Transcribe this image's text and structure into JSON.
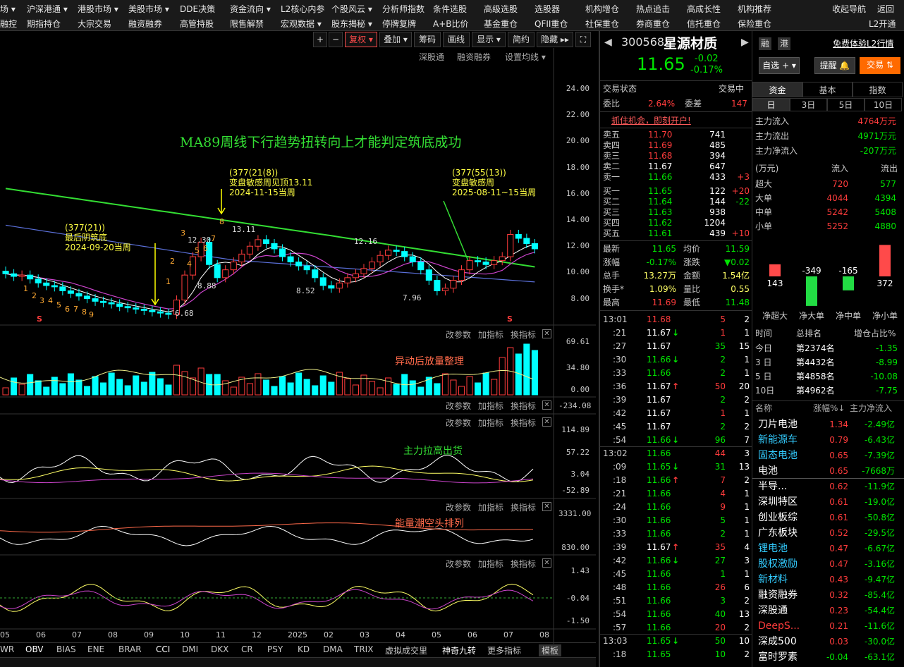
{
  "menu_row1": [
    {
      "label": "场 ▾",
      "x": 0
    },
    {
      "label": "沪深港通 ▾",
      "x": 38
    },
    {
      "label": "港股市场 ▾",
      "x": 110
    },
    {
      "label": "美股市场 ▾",
      "x": 182
    },
    {
      "label": "DDE决策",
      "x": 255
    },
    {
      "label": "资金流向 ▾",
      "x": 326
    },
    {
      "label": "L2核心内参",
      "x": 398
    },
    {
      "label": "个股风云 ▾",
      "x": 470
    },
    {
      "label": "分析师指数",
      "x": 542
    },
    {
      "label": "条件选股",
      "x": 614
    },
    {
      "label": "高级选股",
      "x": 686
    },
    {
      "label": "选股器",
      "x": 758
    },
    {
      "label": "机构增仓",
      "x": 830
    },
    {
      "label": "热点追击",
      "x": 902
    },
    {
      "label": "高成长性",
      "x": 974
    },
    {
      "label": "机构推荐",
      "x": 1046
    },
    {
      "label": "收起导航",
      "x": 1180
    },
    {
      "label": "返回",
      "x": 1244
    }
  ],
  "menu_row2": [
    {
      "label": "融控",
      "x": 0
    },
    {
      "label": "期指持仓",
      "x": 38
    },
    {
      "label": "大宗交易",
      "x": 110
    },
    {
      "label": "融资融券",
      "x": 182
    },
    {
      "label": "高管持股",
      "x": 255
    },
    {
      "label": "限售解禁",
      "x": 326
    },
    {
      "label": "宏观数据 ▾",
      "x": 398
    },
    {
      "label": "股东揭秘 ▾",
      "x": 470
    },
    {
      "label": "停牌复牌",
      "x": 542
    },
    {
      "label": "A+B比价",
      "x": 614
    },
    {
      "label": "基金重仓",
      "x": 686
    },
    {
      "label": "QFII重仓",
      "x": 758
    },
    {
      "label": "社保重仓",
      "x": 830
    },
    {
      "label": "券商重仓",
      "x": 902
    },
    {
      "label": "信托重仓",
      "x": 974
    },
    {
      "label": "保险重仓",
      "x": 1046
    },
    {
      "label": "L2开通",
      "x": 1232
    }
  ],
  "toolbar": {
    "plus": "+",
    "minus": "−",
    "fuquan": "复权 ▾",
    "diejia": "叠加 ▾",
    "chouma": "筹码",
    "huaxian": "画线",
    "xianshi": "显示 ▾",
    "jianyue": "简约",
    "yincang": "隐藏 ▸▸",
    "full": "⛶"
  },
  "main_chart": {
    "top_links": [
      "深股通",
      "融资融券",
      "设置均线 ▾"
    ],
    "y_ticks": [
      "24.00",
      "22.00",
      "20.00",
      "18.00",
      "16.00",
      "14.00",
      "12.00",
      "10.00",
      "8.00"
    ],
    "headline": "MA89周线下行趋势扭转向上才能判定筑底成功",
    "annotations": [
      {
        "l1": "(377(21))",
        "l2": "最后阴筑底",
        "l3": "2024-09-20当周"
      },
      {
        "l1": "(377(21(8))",
        "l2": "变盘敏感周见顶13.11",
        "l3": "2024-11-15当周"
      },
      {
        "l1": "(377(55(13))",
        "l2": "变盘敏感周",
        "l3": "2025-08-11~15当周"
      }
    ],
    "price_labels": [
      "12.30",
      "13.11",
      "8.88",
      "8.52",
      "12.16",
      "7.96",
      "6.68"
    ],
    "td_counts_left": [
      "1",
      "2",
      "3",
      "4",
      "5",
      "6",
      "7",
      "8",
      "9"
    ],
    "td_counts_right": [
      "1",
      "2",
      "3",
      "4",
      "5",
      "6",
      "7",
      "8"
    ],
    "s_marks": [
      "S",
      "S"
    ]
  },
  "panels": {
    "links": [
      "改参数",
      "加指标",
      "换指标"
    ],
    "vol": {
      "note": "异动后放量整理",
      "y": [
        "69.61",
        "34.80",
        "0.00"
      ]
    },
    "p2": {
      "y": [
        "-234.08"
      ],
      "extra": "−234.08"
    },
    "main_force": {
      "note": "主力拉高出货",
      "y": [
        "114.89",
        "57.22",
        "3.04",
        "-52.89"
      ]
    },
    "energy": {
      "note": "能量潮空头排列",
      "y": [
        "3331.00",
        "830.00"
      ]
    },
    "osc": {
      "y": [
        "1.43",
        "-0.04",
        "-1.50"
      ]
    }
  },
  "x_axis": [
    "05",
    "06",
    "07",
    "08",
    "09",
    "10",
    "11",
    "12",
    "2025",
    "02",
    "03",
    "04",
    "05",
    "06",
    "07",
    "08"
  ],
  "indicator_tabs": [
    "WR",
    "OBV",
    "BIAS",
    "ENE",
    "BRAR",
    "CCI",
    "DMI",
    "DKX",
    "CR",
    "PSY",
    "KD",
    "DMA",
    "TRIX",
    "虚拟成交里",
    "神奇九转",
    "更多指标",
    "模板"
  ],
  "quote": {
    "code": "300568",
    "name": "星源材质",
    "price": "11.65",
    "change": "-0.02",
    "change_pct": "-0.17%",
    "tag1": "融",
    "tag2": "港",
    "l2_link": "免费体验L2行情",
    "btn_zixuan": "自选 + ▾",
    "btn_tixing": "提醒 🔔",
    "btn_jiaoyi": "交易 ⇅",
    "status_label": "交易状态",
    "status_value": "交易中",
    "weibi_label": "委比",
    "weibi": "2.64%",
    "weicha_label": "委差",
    "weicha": "147",
    "promo": "抓住机会，即刻开户!"
  },
  "asks": [
    {
      "label": "卖五",
      "price": "11.70",
      "vol": "741",
      "chg": ""
    },
    {
      "label": "卖四",
      "price": "11.69",
      "vol": "485",
      "chg": ""
    },
    {
      "label": "卖三",
      "price": "11.68",
      "vol": "394",
      "chg": ""
    },
    {
      "label": "卖二",
      "price": "11.67",
      "vol": "647",
      "chg": ""
    },
    {
      "label": "卖一",
      "price": "11.66",
      "vol": "433",
      "chg": "+3"
    }
  ],
  "bids": [
    {
      "label": "买一",
      "price": "11.65",
      "vol": "122",
      "chg": "+20"
    },
    {
      "label": "买二",
      "price": "11.64",
      "vol": "144",
      "chg": "-22"
    },
    {
      "label": "买三",
      "price": "11.63",
      "vol": "938",
      "chg": ""
    },
    {
      "label": "买四",
      "price": "11.62",
      "vol": "1204",
      "chg": ""
    },
    {
      "label": "买五",
      "price": "11.61",
      "vol": "439",
      "chg": "+10"
    }
  ],
  "stats": [
    {
      "l": "最新",
      "v": "11.65",
      "l2": "均价",
      "v2": "11.59"
    },
    {
      "l": "涨幅",
      "v": "-0.17%",
      "l2": "涨跌",
      "v2": "▼0.02"
    },
    {
      "l": "总手",
      "v": "13.27万",
      "l2": "金额",
      "v2": "1.54亿"
    },
    {
      "l": "换手*",
      "v": "1.09%",
      "l2": "量比",
      "v2": "0.55"
    },
    {
      "l": "最高",
      "v": "11.69",
      "l2": "最低",
      "v2": "11.48"
    }
  ],
  "ticks": [
    {
      "t": "13:01",
      "p": "11.68",
      "a": "",
      "v": "5",
      "n": "2",
      "pc": "red",
      "vc": "red"
    },
    {
      "t": ":21",
      "p": "11.67",
      "a": "↓",
      "v": "1",
      "n": "1",
      "pc": "white",
      "vc": "red"
    },
    {
      "t": ":27",
      "p": "11.67",
      "a": "",
      "v": "35",
      "n": "15",
      "pc": "white",
      "vc": "green"
    },
    {
      "t": ":30",
      "p": "11.66",
      "a": "↓",
      "v": "2",
      "n": "1",
      "pc": "green",
      "vc": "green"
    },
    {
      "t": ":33",
      "p": "11.66",
      "a": "",
      "v": "2",
      "n": "1",
      "pc": "green",
      "vc": "green"
    },
    {
      "t": ":36",
      "p": "11.67",
      "a": "↑",
      "v": "50",
      "n": "20",
      "pc": "white",
      "vc": "red"
    },
    {
      "t": ":39",
      "p": "11.67",
      "a": "",
      "v": "2",
      "n": "2",
      "pc": "white",
      "vc": "green"
    },
    {
      "t": ":42",
      "p": "11.67",
      "a": "",
      "v": "1",
      "n": "1",
      "pc": "white",
      "vc": "red"
    },
    {
      "t": ":45",
      "p": "11.67",
      "a": "",
      "v": "2",
      "n": "2",
      "pc": "white",
      "vc": "green"
    },
    {
      "t": ":54",
      "p": "11.66",
      "a": "↓",
      "v": "96",
      "n": "7",
      "pc": "green",
      "vc": "green"
    },
    {
      "t": "13:02",
      "p": "11.66",
      "a": "",
      "v": "44",
      "n": "3",
      "pc": "green",
      "vc": "red"
    },
    {
      "t": ":09",
      "p": "11.65",
      "a": "↓",
      "v": "31",
      "n": "13",
      "pc": "green",
      "vc": "green"
    },
    {
      "t": ":18",
      "p": "11.66",
      "a": "↑",
      "v": "7",
      "n": "2",
      "pc": "green",
      "vc": "red"
    },
    {
      "t": ":21",
      "p": "11.66",
      "a": "",
      "v": "4",
      "n": "1",
      "pc": "green",
      "vc": "red"
    },
    {
      "t": ":24",
      "p": "11.66",
      "a": "",
      "v": "9",
      "n": "1",
      "pc": "green",
      "vc": "red"
    },
    {
      "t": ":30",
      "p": "11.66",
      "a": "",
      "v": "5",
      "n": "1",
      "pc": "green",
      "vc": "green"
    },
    {
      "t": ":33",
      "p": "11.66",
      "a": "",
      "v": "2",
      "n": "1",
      "pc": "green",
      "vc": "green"
    },
    {
      "t": ":39",
      "p": "11.67",
      "a": "↑",
      "v": "35",
      "n": "4",
      "pc": "white",
      "vc": "red"
    },
    {
      "t": ":42",
      "p": "11.66",
      "a": "↓",
      "v": "27",
      "n": "3",
      "pc": "green",
      "vc": "green"
    },
    {
      "t": ":45",
      "p": "11.66",
      "a": "",
      "v": "1",
      "n": "1",
      "pc": "green",
      "vc": "green"
    },
    {
      "t": ":48",
      "p": "11.66",
      "a": "",
      "v": "26",
      "n": "6",
      "pc": "green",
      "vc": "red"
    },
    {
      "t": ":51",
      "p": "11.66",
      "a": "",
      "v": "3",
      "n": "2",
      "pc": "green",
      "vc": "green"
    },
    {
      "t": ":54",
      "p": "11.66",
      "a": "",
      "v": "40",
      "n": "13",
      "pc": "green",
      "vc": "green"
    },
    {
      "t": ":57",
      "p": "11.66",
      "a": "",
      "v": "20",
      "n": "2",
      "pc": "green",
      "vc": "red"
    },
    {
      "t": "13:03",
      "p": "11.65",
      "a": "↓",
      "v": "50",
      "n": "10",
      "pc": "green",
      "vc": "green"
    },
    {
      "t": ":18",
      "p": "11.65",
      "a": "",
      "v": "10",
      "n": "2",
      "pc": "green",
      "vc": "green"
    }
  ],
  "flow": {
    "tabs": [
      "资金",
      "基本",
      "指数"
    ],
    "periods": [
      "日",
      "3日",
      "5日",
      "10日"
    ],
    "summary": [
      {
        "l": "主力流入",
        "v": "4764",
        "u": "万元",
        "c": "red"
      },
      {
        "l": "主力流出",
        "v": "4971",
        "u": "万元",
        "c": "green"
      },
      {
        "l": "主力净流入",
        "v": "-207",
        "u": "万元",
        "c": "green"
      }
    ],
    "unit": "(万元)",
    "col_in": "流入",
    "col_out": "流出",
    "rows": [
      {
        "l": "超大",
        "in": "720",
        "out": "577"
      },
      {
        "l": "大单",
        "in": "4044",
        "out": "4394"
      },
      {
        "l": "中单",
        "in": "5242",
        "out": "5408"
      },
      {
        "l": "小单",
        "in": "5252",
        "out": "4880"
      }
    ],
    "net_bars": [
      {
        "label": "净超大",
        "value": 143
      },
      {
        "label": "净大单",
        "value": -349
      },
      {
        "label": "净中单",
        "value": -165
      },
      {
        "label": "净小单",
        "value": 372
      }
    ],
    "rank_header": [
      "时间",
      "总排名",
      "增仓占比%"
    ],
    "ranks": [
      {
        "t": "今日",
        "r": "第2374名",
        "p": "-1.35"
      },
      {
        "t": "3 日",
        "r": "第4432名",
        "p": "-8.99"
      },
      {
        "t": "5 日",
        "r": "第4858名",
        "p": "-10.08"
      },
      {
        "t": "10日",
        "r": "第4962名",
        "p": "-7.75"
      }
    ]
  },
  "sectors_header": [
    "名称",
    "涨幅%↓",
    "主力净流入"
  ],
  "sectors": [
    {
      "n": "刀片电池",
      "p": "1.34",
      "f": "-2.49亿",
      "nc": "white"
    },
    {
      "n": "新能源车",
      "p": "0.79",
      "f": "-6.43亿",
      "nc": "cyan"
    },
    {
      "n": "固态电池",
      "p": "0.65",
      "f": "-7.39亿",
      "nc": "cyan"
    },
    {
      "n": "电池",
      "p": "0.65",
      "f": "-7668万",
      "nc": "white"
    },
    {
      "n": "半导...",
      "p": "0.62",
      "f": "-11.9亿",
      "nc": "white"
    },
    {
      "n": "深圳特区",
      "p": "0.61",
      "f": "-19.0亿",
      "nc": "white"
    },
    {
      "n": "创业板综",
      "p": "0.61",
      "f": "-50.8亿",
      "nc": "white"
    },
    {
      "n": "广东板块",
      "p": "0.52",
      "f": "-29.5亿",
      "nc": "white"
    },
    {
      "n": "锂电池",
      "p": "0.47",
      "f": "-6.67亿",
      "nc": "cyan"
    },
    {
      "n": "股权激励",
      "p": "0.47",
      "f": "-3.16亿",
      "nc": "cyan"
    },
    {
      "n": "新材料",
      "p": "0.43",
      "f": "-9.47亿",
      "nc": "cyan"
    },
    {
      "n": "融资融券",
      "p": "0.32",
      "f": "-85.4亿",
      "nc": "white"
    },
    {
      "n": "深股通",
      "p": "0.23",
      "f": "-54.4亿",
      "nc": "white"
    },
    {
      "n": "DeepS...",
      "p": "0.21",
      "f": "-11.6亿",
      "nc": "red"
    },
    {
      "n": "深成500",
      "p": "0.03",
      "f": "-30.0亿",
      "nc": "white"
    },
    {
      "n": "富时罗素",
      "p": "-0.04",
      "f": "-63.1亿",
      "nc": "white"
    }
  ],
  "colors": {
    "up": "#ff3c3c",
    "down": "#00e600",
    "ma89": "#33dd33",
    "candle_down": "#00ffff"
  }
}
